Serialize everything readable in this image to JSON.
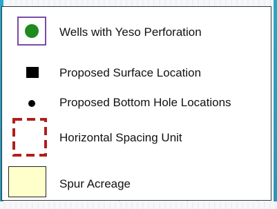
{
  "legend": {
    "items": [
      {
        "label": "Wells with Yeso Perforation",
        "symbol": "green-dot-purple-box",
        "color": "#1f8a1f",
        "box_color": "#7a4aa8"
      },
      {
        "label": "Proposed Surface Location",
        "symbol": "black-square",
        "color": "#000000"
      },
      {
        "label": "Proposed Bottom Hole Locations",
        "symbol": "black-dot",
        "color": "#000000"
      },
      {
        "label": "Horizontal Spacing Unit",
        "symbol": "red-dashed-rectangle",
        "color": "#b01e1e"
      },
      {
        "label": "Spur Acreage",
        "symbol": "yellow-rectangle",
        "color": "#ffffcc"
      }
    ]
  }
}
